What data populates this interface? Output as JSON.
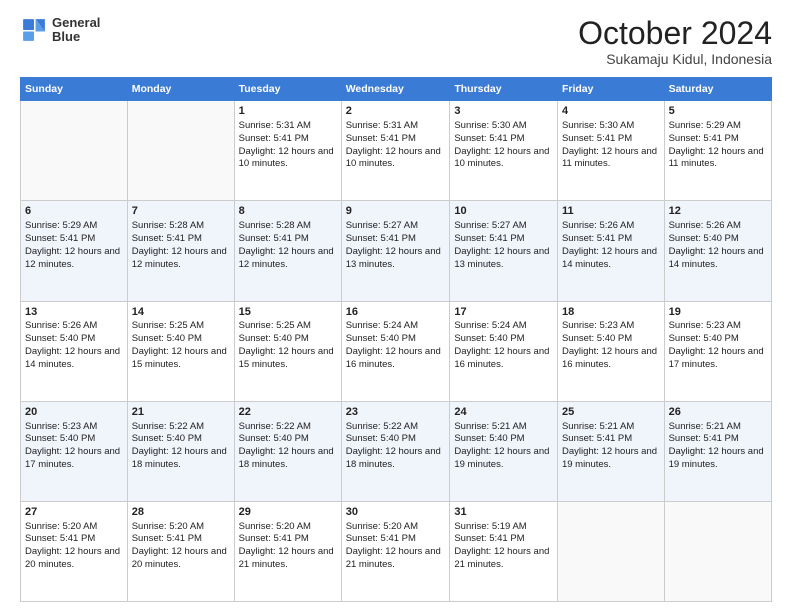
{
  "logo": {
    "line1": "General",
    "line2": "Blue"
  },
  "title": "October 2024",
  "location": "Sukamaju Kidul, Indonesia",
  "days_of_week": [
    "Sunday",
    "Monday",
    "Tuesday",
    "Wednesday",
    "Thursday",
    "Friday",
    "Saturday"
  ],
  "weeks": [
    [
      {
        "day": null,
        "data": null
      },
      {
        "day": null,
        "data": null
      },
      {
        "day": "1",
        "data": "Sunrise: 5:31 AM\nSunset: 5:41 PM\nDaylight: 12 hours and 10 minutes."
      },
      {
        "day": "2",
        "data": "Sunrise: 5:31 AM\nSunset: 5:41 PM\nDaylight: 12 hours and 10 minutes."
      },
      {
        "day": "3",
        "data": "Sunrise: 5:30 AM\nSunset: 5:41 PM\nDaylight: 12 hours and 10 minutes."
      },
      {
        "day": "4",
        "data": "Sunrise: 5:30 AM\nSunset: 5:41 PM\nDaylight: 12 hours and 11 minutes."
      },
      {
        "day": "5",
        "data": "Sunrise: 5:29 AM\nSunset: 5:41 PM\nDaylight: 12 hours and 11 minutes."
      }
    ],
    [
      {
        "day": "6",
        "data": "Sunrise: 5:29 AM\nSunset: 5:41 PM\nDaylight: 12 hours and 12 minutes."
      },
      {
        "day": "7",
        "data": "Sunrise: 5:28 AM\nSunset: 5:41 PM\nDaylight: 12 hours and 12 minutes."
      },
      {
        "day": "8",
        "data": "Sunrise: 5:28 AM\nSunset: 5:41 PM\nDaylight: 12 hours and 12 minutes."
      },
      {
        "day": "9",
        "data": "Sunrise: 5:27 AM\nSunset: 5:41 PM\nDaylight: 12 hours and 13 minutes."
      },
      {
        "day": "10",
        "data": "Sunrise: 5:27 AM\nSunset: 5:41 PM\nDaylight: 12 hours and 13 minutes."
      },
      {
        "day": "11",
        "data": "Sunrise: 5:26 AM\nSunset: 5:41 PM\nDaylight: 12 hours and 14 minutes."
      },
      {
        "day": "12",
        "data": "Sunrise: 5:26 AM\nSunset: 5:40 PM\nDaylight: 12 hours and 14 minutes."
      }
    ],
    [
      {
        "day": "13",
        "data": "Sunrise: 5:26 AM\nSunset: 5:40 PM\nDaylight: 12 hours and 14 minutes."
      },
      {
        "day": "14",
        "data": "Sunrise: 5:25 AM\nSunset: 5:40 PM\nDaylight: 12 hours and 15 minutes."
      },
      {
        "day": "15",
        "data": "Sunrise: 5:25 AM\nSunset: 5:40 PM\nDaylight: 12 hours and 15 minutes."
      },
      {
        "day": "16",
        "data": "Sunrise: 5:24 AM\nSunset: 5:40 PM\nDaylight: 12 hours and 16 minutes."
      },
      {
        "day": "17",
        "data": "Sunrise: 5:24 AM\nSunset: 5:40 PM\nDaylight: 12 hours and 16 minutes."
      },
      {
        "day": "18",
        "data": "Sunrise: 5:23 AM\nSunset: 5:40 PM\nDaylight: 12 hours and 16 minutes."
      },
      {
        "day": "19",
        "data": "Sunrise: 5:23 AM\nSunset: 5:40 PM\nDaylight: 12 hours and 17 minutes."
      }
    ],
    [
      {
        "day": "20",
        "data": "Sunrise: 5:23 AM\nSunset: 5:40 PM\nDaylight: 12 hours and 17 minutes."
      },
      {
        "day": "21",
        "data": "Sunrise: 5:22 AM\nSunset: 5:40 PM\nDaylight: 12 hours and 18 minutes."
      },
      {
        "day": "22",
        "data": "Sunrise: 5:22 AM\nSunset: 5:40 PM\nDaylight: 12 hours and 18 minutes."
      },
      {
        "day": "23",
        "data": "Sunrise: 5:22 AM\nSunset: 5:40 PM\nDaylight: 12 hours and 18 minutes."
      },
      {
        "day": "24",
        "data": "Sunrise: 5:21 AM\nSunset: 5:40 PM\nDaylight: 12 hours and 19 minutes."
      },
      {
        "day": "25",
        "data": "Sunrise: 5:21 AM\nSunset: 5:41 PM\nDaylight: 12 hours and 19 minutes."
      },
      {
        "day": "26",
        "data": "Sunrise: 5:21 AM\nSunset: 5:41 PM\nDaylight: 12 hours and 19 minutes."
      }
    ],
    [
      {
        "day": "27",
        "data": "Sunrise: 5:20 AM\nSunset: 5:41 PM\nDaylight: 12 hours and 20 minutes."
      },
      {
        "day": "28",
        "data": "Sunrise: 5:20 AM\nSunset: 5:41 PM\nDaylight: 12 hours and 20 minutes."
      },
      {
        "day": "29",
        "data": "Sunrise: 5:20 AM\nSunset: 5:41 PM\nDaylight: 12 hours and 21 minutes."
      },
      {
        "day": "30",
        "data": "Sunrise: 5:20 AM\nSunset: 5:41 PM\nDaylight: 12 hours and 21 minutes."
      },
      {
        "day": "31",
        "data": "Sunrise: 5:19 AM\nSunset: 5:41 PM\nDaylight: 12 hours and 21 minutes."
      },
      {
        "day": null,
        "data": null
      },
      {
        "day": null,
        "data": null
      }
    ]
  ]
}
